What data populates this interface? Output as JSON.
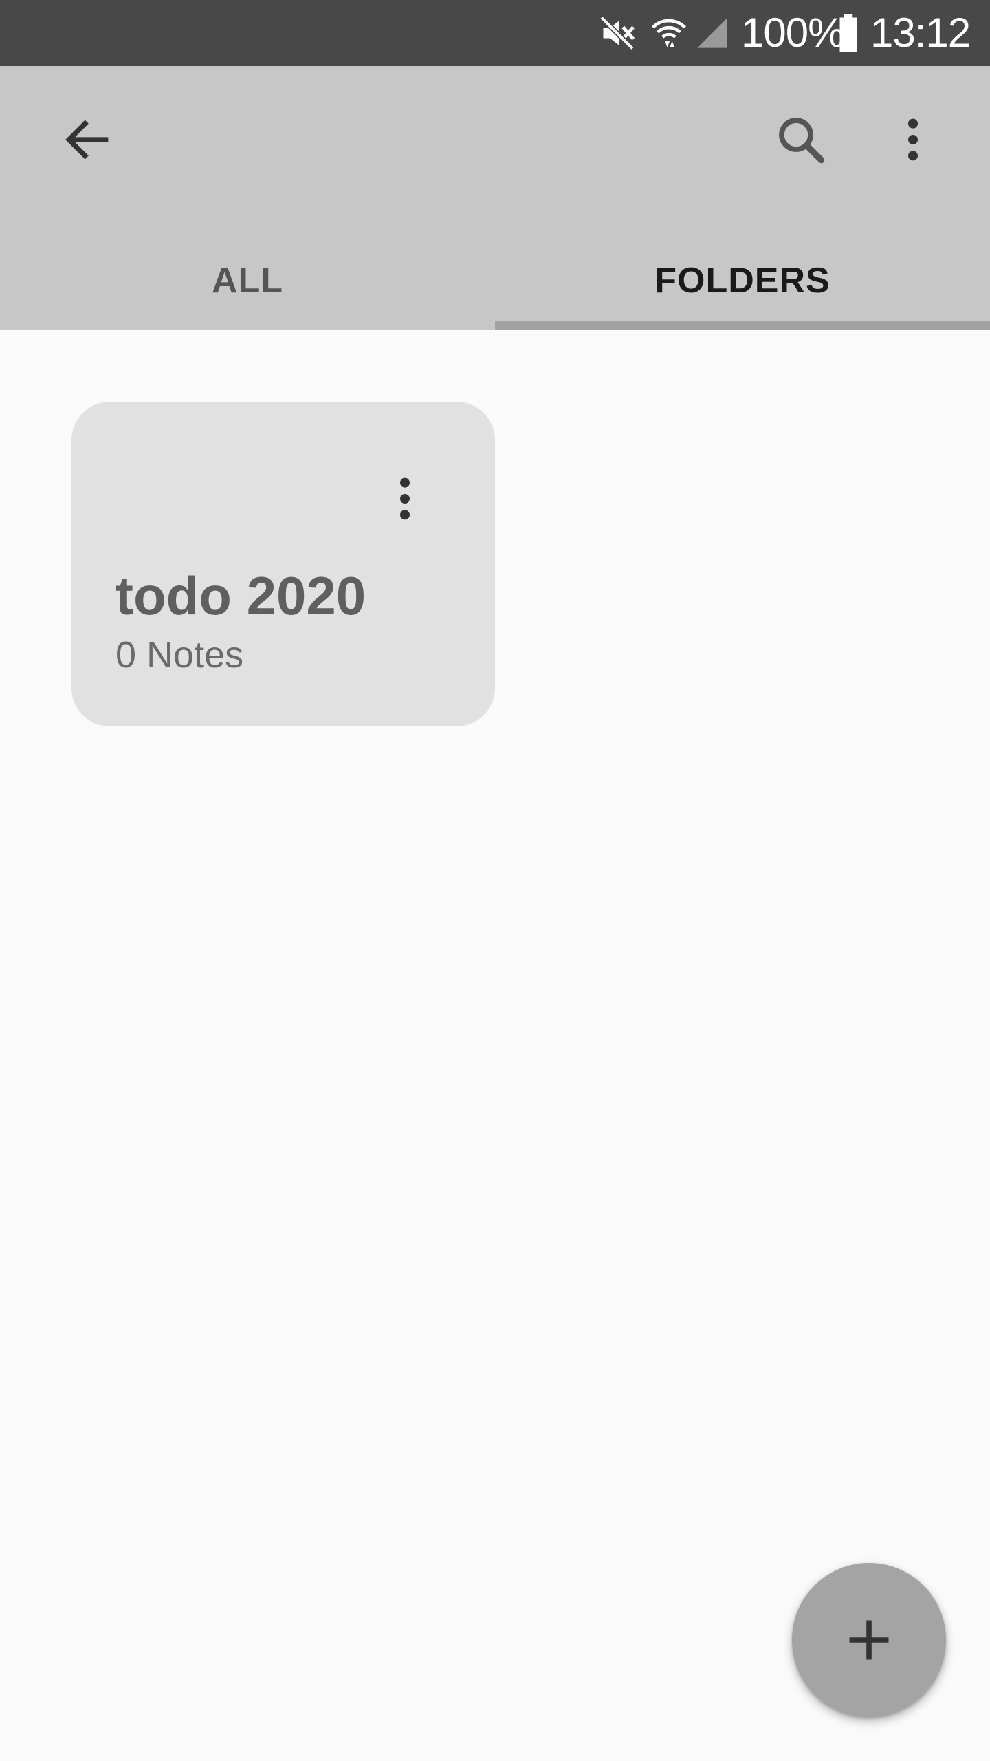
{
  "status_bar": {
    "battery_percent": "100%",
    "time": "13:12",
    "icons": [
      "mute-icon",
      "wifi-icon",
      "cell-signal-icon",
      "battery-icon"
    ]
  },
  "app_bar": {
    "icons": [
      "back-arrow-icon",
      "search-icon",
      "more-vert-icon"
    ]
  },
  "tabs": [
    {
      "label": "ALL",
      "selected": false
    },
    {
      "label": "FOLDERS",
      "selected": true
    }
  ],
  "folders": [
    {
      "name": "todo 2020",
      "count": "0 Notes"
    }
  ],
  "fab": {
    "icon": "plus-icon"
  },
  "colors": {
    "status_bar_bg": "#484848",
    "app_bar_bg": "#c8c7c8",
    "tab_indicator": "#a2a2a2",
    "page_bg": "#fafafa",
    "card_bg": "#e1e1e1",
    "fab_bg": "#a4a4a4"
  }
}
